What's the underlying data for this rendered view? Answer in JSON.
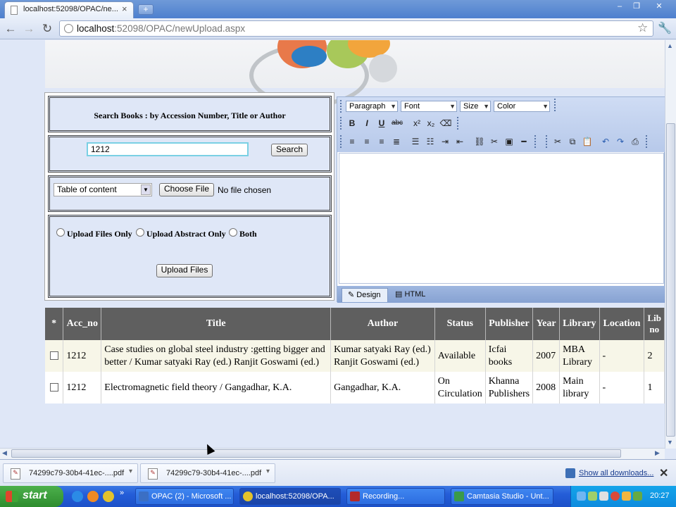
{
  "browser": {
    "tab_title": "localhost:52098/OPAC/ne...",
    "url_host": "localhost",
    "url_rest": ":52098/OPAC/newUpload.aspx",
    "new_tab": "+"
  },
  "search": {
    "title": "Search Books :  by Accession Number, Title or Author",
    "input_value": "1212",
    "button": "Search"
  },
  "upload": {
    "select_value": "Table of content",
    "choose_button": "Choose File",
    "no_file": "No file chosen",
    "radio_1": "Upload Files Only",
    "radio_2": "Upload Abstract Only",
    "radio_3": "Both",
    "upload_button": "Upload Files"
  },
  "editor": {
    "paragraph": "Paragraph",
    "font": "Font",
    "size": "Size",
    "color": "Color",
    "design_tab": "Design",
    "html_tab": "HTML"
  },
  "grid": {
    "headers": [
      "*",
      "Acc_no",
      "Title",
      "Author",
      "Status",
      "Publisher",
      "Year",
      "Library",
      "Location",
      "Lib no"
    ],
    "rows": [
      {
        "acc": "1212",
        "title": "Case studies on global steel industry :getting bigger and better / Kumar satyaki Ray (ed.) Ranjit Goswami (ed.)",
        "author": "Kumar satyaki Ray (ed.) Ranjit Goswami (ed.)",
        "status": "Available",
        "publisher": "Icfai books",
        "year": "2007",
        "library": "MBA Library",
        "location": "-",
        "libno": "2"
      },
      {
        "acc": "1212",
        "title": "Electromagnetic field theory / Gangadhar, K.A.",
        "author": "Gangadhar, K.A.",
        "status": "On Circulation",
        "publisher": "Khanna Publishers",
        "year": "2008",
        "library": "Main library",
        "location": "-",
        "libno": "1"
      }
    ]
  },
  "downloads": {
    "item_1": "74299c79-30b4-41ec-....pdf",
    "item_2": "74299c79-30b4-41ec-....pdf",
    "show_all": "Show all downloads..."
  },
  "taskbar": {
    "start": "start",
    "item_1": "OPAC (2) - Microsoft ...",
    "item_2": "localhost:52098/OPA...",
    "item_3": "Recording...",
    "item_4": "Camtasia Studio - Unt...",
    "clock": "20:27"
  },
  "colors": {
    "accent": "#245dd8",
    "grid_header": "#5f5f5f",
    "row_alt": "#f7f6e8",
    "page_bg": "#dfe7f7"
  }
}
